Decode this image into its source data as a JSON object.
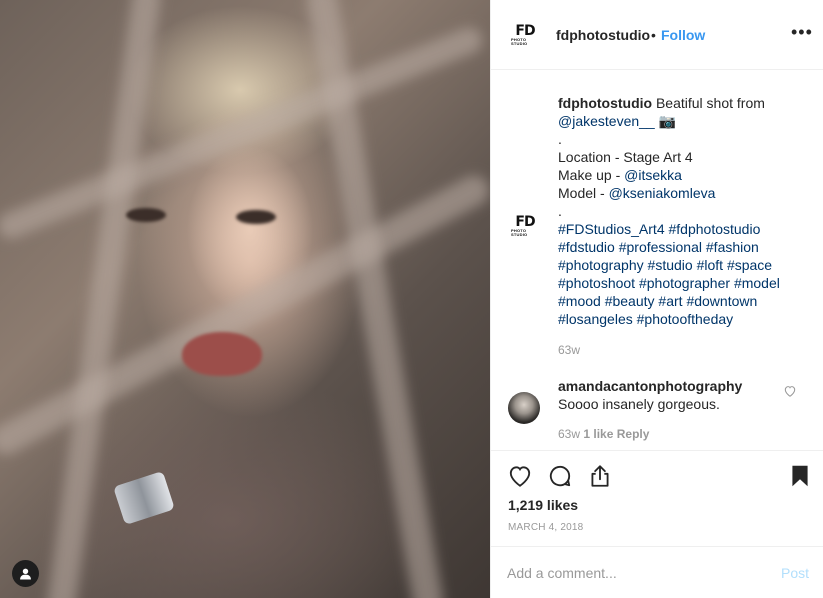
{
  "post": {
    "account": {
      "username": "fdphotostudio",
      "logo_text": "FD",
      "logo_sub": "PHOTO STUDIO",
      "follow_separator": "•",
      "follow_label": "Follow",
      "more_label": "•••"
    },
    "caption": {
      "username": "fdphotostudio",
      "line1_text": "Beatiful shot from",
      "line2_mention": "@jakesteven__",
      "line2_emoji": "📷",
      "sep1": ".",
      "location": "Location - Stage Art 4",
      "makeup_label": "Make up -",
      "makeup_mention": "@itsekka",
      "model_label": "Model -",
      "model_mention": "@kseniakomleva",
      "sep2": ".",
      "hashtag_lines": [
        [
          "#FDStudios_Art4",
          "#fdphotostudio"
        ],
        [
          "#fdstudio",
          "#professional",
          "#fashion"
        ],
        [
          "#photography",
          "#studio",
          "#loft",
          "#space"
        ],
        [
          "#photoshoot",
          "#photographer",
          "#model"
        ],
        [
          "#mood",
          "#beauty",
          "#art",
          "#downtown"
        ],
        [
          "#losangeles",
          "#photooftheday"
        ]
      ],
      "time": "63w"
    },
    "comment": {
      "username": "amandacantonphotography",
      "text": "Soooo insanely gorgeous.",
      "time": "63w",
      "likes": "1 like",
      "reply": "Reply"
    },
    "likes": "1,219 likes",
    "date": "MARCH 4, 2018",
    "add_comment": {
      "placeholder": "Add a comment...",
      "post_label": "Post"
    }
  },
  "icons": {
    "like": "heart-icon",
    "comment": "comment-icon",
    "share": "share-icon",
    "save": "bookmark-icon",
    "tagged": "user-icon"
  },
  "colors": {
    "link": "#003569",
    "follow": "#3897f0",
    "muted": "#999999",
    "post_disabled": "#b2dffc"
  }
}
